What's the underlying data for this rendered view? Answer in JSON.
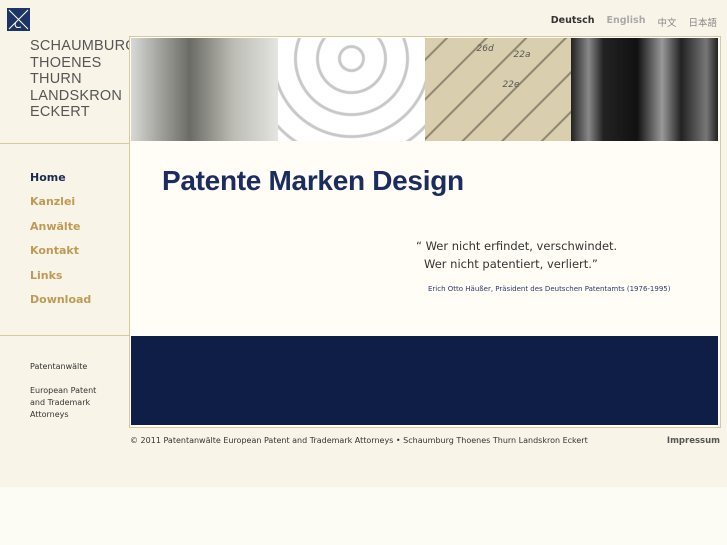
{
  "header": {
    "firm_name": [
      "SCHAUMBURG",
      "THOENES",
      "THURN",
      "LANDSKRON",
      "ECKERT"
    ],
    "languages": [
      {
        "label": "Deutsch",
        "active": true
      },
      {
        "label": "English",
        "active": false
      },
      {
        "label": "中文",
        "active": false
      },
      {
        "label": "日本語",
        "active": false
      }
    ],
    "banner_labels": [
      "26d",
      "22a",
      "22e"
    ]
  },
  "nav": {
    "items": [
      "Home",
      "Kanzlei",
      "Anwälte",
      "Kontakt",
      "Links",
      "Download"
    ]
  },
  "sidebar": {
    "line1": "Patentanwälte",
    "line2": "European Patent",
    "line3": "and Trademark",
    "line4": "Attorneys"
  },
  "main": {
    "title": "Patente Marken Design",
    "quote_line1": "“ Wer nicht erfindet, verschwindet.",
    "quote_line2": "Wer nicht patentiert, verliert.”",
    "author": "Erich Otto Häußer, Präsident des Deutschen Patentamts (1976-1995)"
  },
  "footer": {
    "copyright": "© 2011 Patentanwälte European Patent and Trademark Attorneys • Schaumburg Thoenes Thurn Landskron Eckert",
    "impressum": "Impressum"
  },
  "colors": {
    "navy": "#0e1e47",
    "nav_link": "#c09a55",
    "title": "#1b2c5e"
  }
}
